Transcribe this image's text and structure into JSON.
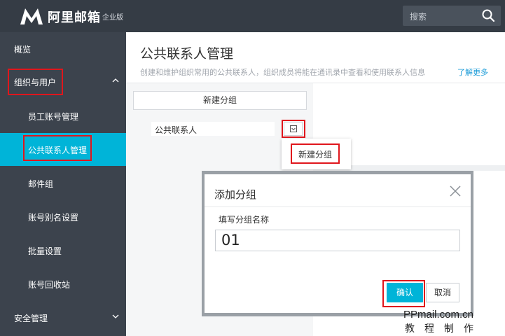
{
  "header": {
    "brand": "阿里邮箱",
    "edition": "企业版",
    "search_placeholder": "搜索"
  },
  "sidebar": {
    "items": [
      {
        "label": "概览"
      },
      {
        "label": "组织与用户"
      },
      {
        "label": "员工账号管理"
      },
      {
        "label": "公共联系人管理"
      },
      {
        "label": "邮件组"
      },
      {
        "label": "账号别名设置"
      },
      {
        "label": "批量设置"
      },
      {
        "label": "账号回收站"
      },
      {
        "label": "安全管理"
      }
    ]
  },
  "main": {
    "title": "公共联系人管理",
    "description": "创建和维护组织常用的公共联系人，组织成员将能在通讯录中查看和使用联系人信息",
    "learn_more": "了解更多",
    "new_group_button": "新建分组",
    "group_name": "公共联系人",
    "dropdown_item": "新建分组"
  },
  "modal": {
    "title": "添加分组",
    "field_label": "填写分组名称",
    "field_value": "01",
    "confirm": "确认",
    "cancel": "取消"
  },
  "watermark": {
    "line1": "PPmail.com.cn",
    "line2": "教程制作"
  },
  "colors": {
    "accent": "#00b4d8",
    "highlight": "#e0161c",
    "sidebar_bg": "#3c434d",
    "header_bg": "#353c45"
  }
}
